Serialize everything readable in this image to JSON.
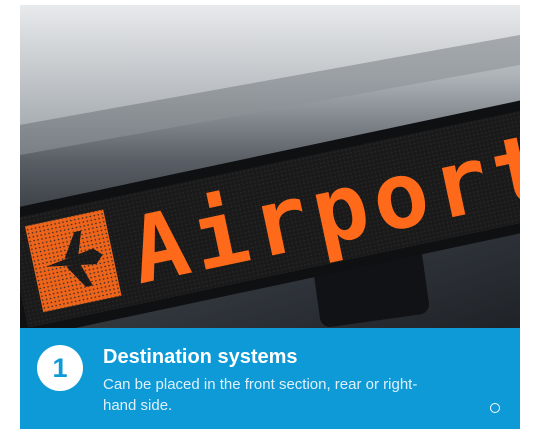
{
  "photo": {
    "sign_text": "Airport",
    "sign_icon": "airplane-icon",
    "sign_color": "#ff6a1a"
  },
  "info": {
    "badge_number": "1",
    "title": "Destination systems",
    "description": "Can be placed in the front section, rear or right-hand side.",
    "accent_color": "#0e9ad7",
    "indicator_icon": "circle-indicator-icon"
  }
}
